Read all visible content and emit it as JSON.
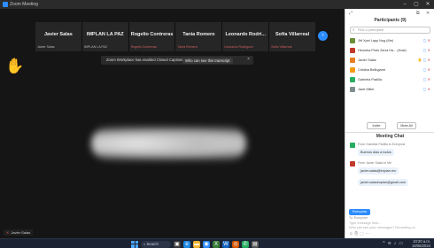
{
  "window": {
    "title": "Zoom Meeting"
  },
  "video_strip": {
    "tiles": [
      {
        "name": "Javier Salas",
        "sub": "Javier Salas",
        "muted": false
      },
      {
        "name": "IMPLAN LA PAZ",
        "sub": "IMPLAN LA PAZ",
        "muted": false
      },
      {
        "name": "Rogelio Contreras",
        "sub": "Rogelio Contreras",
        "muted": true
      },
      {
        "name": "Tania Romero",
        "sub": "Tania Romero",
        "muted": true
      },
      {
        "name": "Leonardo Rodri...",
        "sub": "Leonardo Rodriguez",
        "muted": true
      },
      {
        "name": "Sofía Villarreal",
        "sub": "Sofía Villarreal",
        "muted": true
      }
    ]
  },
  "captions_banner": {
    "text": "Zoom Workplace has enabled Closed Captioning",
    "link": "Who can see this transcript",
    "close": "×"
  },
  "self_view": {
    "label": "Javier Salas"
  },
  "panel": {
    "participants_title": "Participants (9)",
    "search_placeholder": "Find a participant",
    "participants": [
      {
        "name": "Jhf Xpel Lapp Nog (Me)",
        "color": "#6b8f3a",
        "icons": "🎤 ✕"
      },
      {
        "name": "Heureka Pinto Zarra Ha... (Host)",
        "color": "#c0392b",
        "icons": "🎤 ✕"
      },
      {
        "name": "Javier Salas",
        "color": "#e67e22",
        "hand": "✋",
        "icons": "🎤 ✕"
      },
      {
        "name": "Cristina Bellugarre",
        "color": "#f39c12",
        "icons": "🎤 ✕"
      },
      {
        "name": "Gabriela Padilla",
        "color": "#27ae60",
        "icons": "🎤 ✕"
      },
      {
        "name": "Jaret Miller",
        "color": "#7f8c8d",
        "icons": "🎤 ✕"
      }
    ],
    "invite_label": "Invite",
    "mute_all_label": "Mute All",
    "chat_title": "Meeting Chat",
    "messages": [
      {
        "from": "From Gabriela Padilla to Everyone",
        "color": "#27ae60",
        "text": "Buenos días a todos"
      },
      {
        "from": "From Javier Salas to Me",
        "color": "#c0392b",
        "text": "javier.salas@implan.mx"
      },
      {
        "from": "",
        "color": "",
        "text": "javier.salasimplan@gmail.com"
      }
    ],
    "chat_tab": "Everyone",
    "chat_to": "To: Everyone",
    "chat_placeholder": "Type message here...",
    "chat_hint": "Who can see your messages? Recording on"
  },
  "taskbar": {
    "search": "Search",
    "time": "10:20 a.m.",
    "date": "18/06/2024"
  }
}
